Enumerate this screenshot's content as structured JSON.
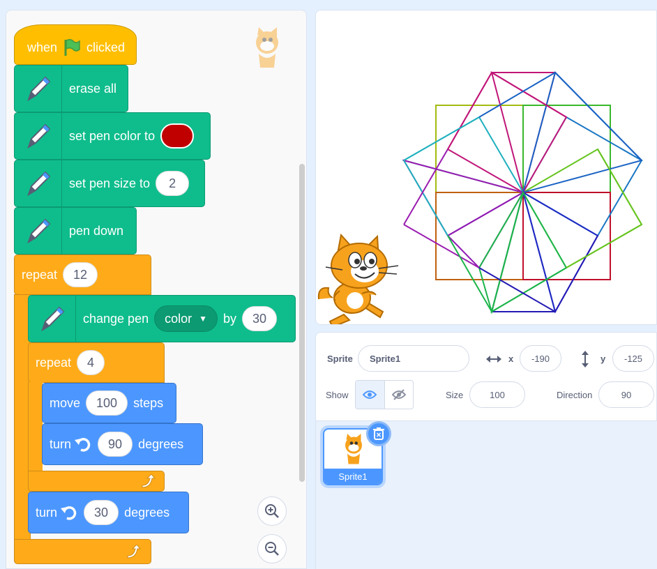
{
  "code": {
    "hat": {
      "when": "when",
      "clicked": "clicked"
    },
    "erase_all": "erase all",
    "set_pen_color": {
      "label": "set pen color to",
      "color": "#c00000"
    },
    "set_pen_size": {
      "label": "set pen size to",
      "value": "2"
    },
    "pen_down": "pen down",
    "repeat_outer": {
      "label": "repeat",
      "value": "12"
    },
    "change_pen": {
      "label": "change pen",
      "param": "color",
      "by": "by",
      "value": "30"
    },
    "repeat_inner": {
      "label": "repeat",
      "value": "4"
    },
    "move": {
      "label": "move",
      "value": "100",
      "unit": "steps"
    },
    "turn_inner": {
      "label": "turn",
      "value": "90",
      "unit": "degrees"
    },
    "turn_outer": {
      "label": "turn",
      "value": "30",
      "unit": "degrees"
    }
  },
  "sprite_info": {
    "sprite_label": "Sprite",
    "sprite_name": "Sprite1",
    "x_label": "x",
    "x_value": "-190",
    "y_label": "y",
    "y_value": "-125",
    "show_label": "Show",
    "size_label": "Size",
    "size_value": "100",
    "direction_label": "Direction",
    "direction_value": "90"
  },
  "sprite_list": [
    {
      "name": "Sprite1"
    }
  ],
  "colors": {
    "pen_block": "#0fbd8c",
    "control_block": "#ffab19",
    "motion_block": "#4c97ff",
    "event_block": "#ffbf00",
    "flag": "#4cbf56"
  }
}
